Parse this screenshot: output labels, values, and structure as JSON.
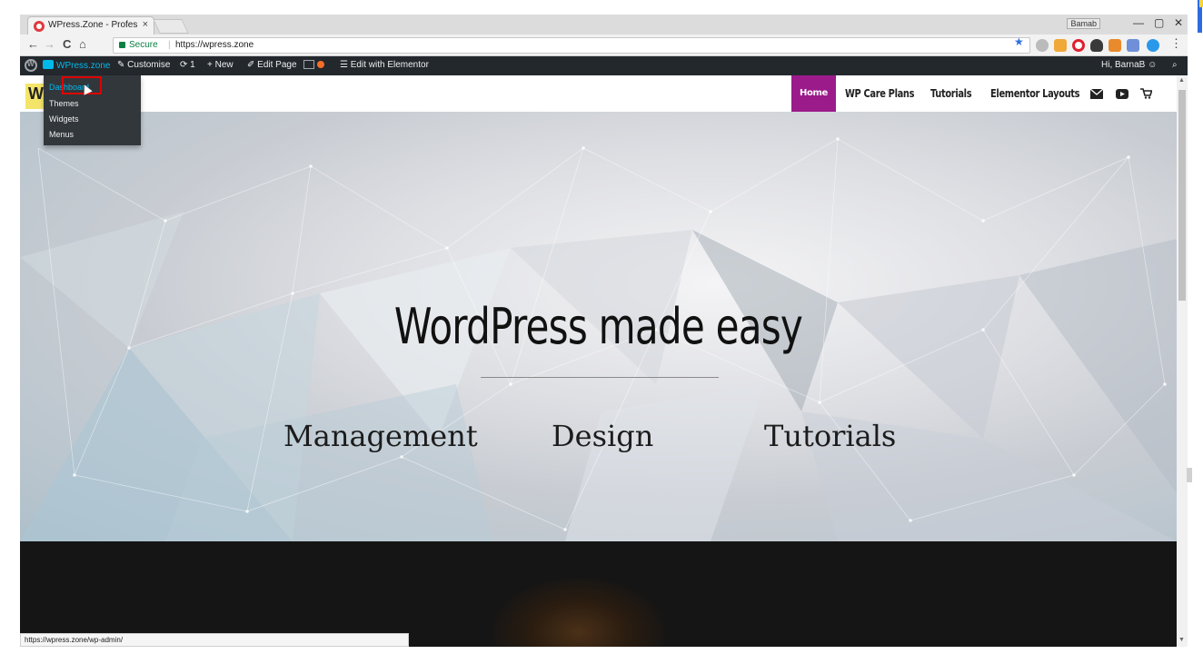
{
  "browser": {
    "tab_title": "WPress.Zone - Professio",
    "tab_close": "×",
    "profile_chip": "Bamab",
    "win_min": "—",
    "win_restore": "▢",
    "win_close": "✕",
    "back": "←",
    "forward": "→",
    "reload": "C",
    "home": "⌂",
    "secure_label": "Secure",
    "url": "https://wpress.zone",
    "star": "★",
    "menu_dots": "⋮"
  },
  "adminbar": {
    "site_name": "WPress.zone",
    "customise": "Customise",
    "updates_count": "1",
    "new_label": "New",
    "edit_page": "Edit Page",
    "edit_elementor": "Edit with Elementor",
    "greeting": "Hi, BarnaB"
  },
  "dropdown": {
    "items": [
      {
        "label": "Dashboard"
      },
      {
        "label": "Themes"
      },
      {
        "label": "Widgets"
      },
      {
        "label": "Menus"
      }
    ]
  },
  "site": {
    "logo_letter": "W",
    "menu": [
      {
        "label": "Home"
      },
      {
        "label": "WP Care Plans"
      },
      {
        "label": "Tutorials"
      },
      {
        "label": "Elementor Layouts"
      }
    ]
  },
  "hero": {
    "title": "WordPress made easy",
    "subtitles": [
      "Management",
      "Design",
      "Tutorials"
    ]
  },
  "status_url": "https://wpress.zone/wp-admin/",
  "colors": {
    "admin_bar": "#23282d",
    "menu_home_bg": "#9b1b8b",
    "secure_green": "#0b8043",
    "wp_blue": "#00b9eb",
    "highlight_red": "#e00000"
  },
  "icons": [
    "wordpress-logo-icon",
    "paintbrush-icon",
    "updates-icon",
    "plus-icon",
    "pencil-icon",
    "yoast-icon",
    "elementor-icon",
    "user-avatar-icon",
    "search-icon",
    "email-icon",
    "youtube-icon",
    "cart-icon",
    "lock-icon",
    "star-icon"
  ]
}
